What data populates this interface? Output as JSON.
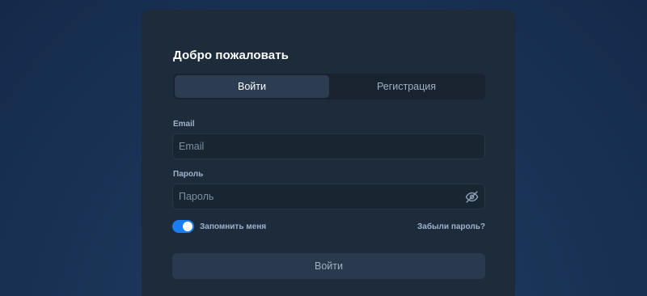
{
  "card": {
    "title": "Добро пожаловать"
  },
  "tabs": [
    {
      "label": "Войти",
      "active": true
    },
    {
      "label": "Регистрация",
      "active": false
    }
  ],
  "email": {
    "label": "Email",
    "placeholder": "Email",
    "value": ""
  },
  "password": {
    "label": "Пароль",
    "placeholder": "Пароль",
    "value": "",
    "visibility_icon": "eye-off-icon"
  },
  "remember": {
    "label": "Запомнить меня",
    "checked": true
  },
  "forgot_link": "Забыли пароль?",
  "submit_label": "Войти",
  "colors": {
    "accent": "#1a7ef2",
    "card_bg": "#1e2b3b",
    "page_bg": "#1b3558"
  }
}
